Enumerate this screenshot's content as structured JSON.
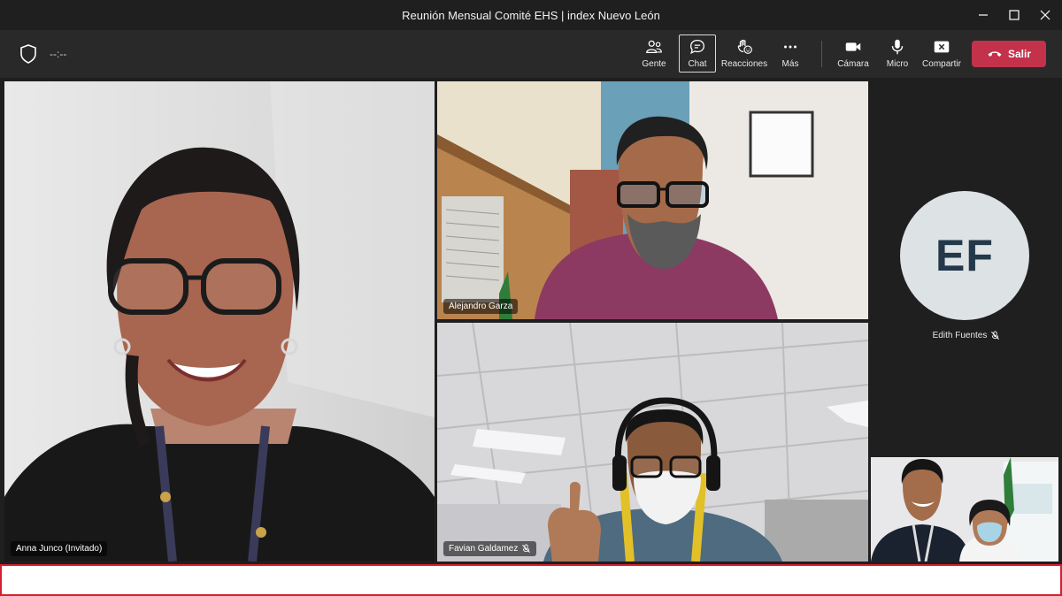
{
  "window": {
    "title": "Reunión Mensual Comité EHS | index Nuevo León"
  },
  "toolbar": {
    "timer": "--:--",
    "buttons": [
      {
        "label": "Gente",
        "icon": "people-icon"
      },
      {
        "label": "Chat",
        "icon": "chat-icon",
        "active": true
      },
      {
        "label": "Reacciones",
        "icon": "reactions-icon"
      },
      {
        "label": "Más",
        "icon": "more-icon"
      },
      {
        "label": "Cámara",
        "icon": "camera-icon"
      },
      {
        "label": "Micro",
        "icon": "microphone-icon"
      },
      {
        "label": "Compartir",
        "icon": "share-icon"
      }
    ],
    "leave_label": "Salir"
  },
  "participants": [
    {
      "name": "Anna Junco (Invitado)",
      "muted": false
    },
    {
      "name": "Alejandro Garza",
      "muted": false
    },
    {
      "name": "Favian Galdamez",
      "muted": true
    },
    {
      "name": "Edith Fuentes",
      "initials": "EF",
      "muted": true
    },
    {
      "name": "",
      "muted": false
    }
  ],
  "colors": {
    "leave": "#c4314b",
    "avatar_bg": "#dde2e5",
    "avatar_text": "#23384a",
    "toolbar": "#292929"
  }
}
